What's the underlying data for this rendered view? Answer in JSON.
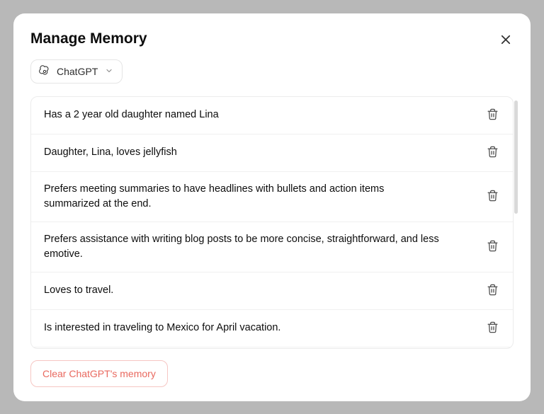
{
  "header": {
    "title": "Manage Memory"
  },
  "model_selector": {
    "label": "ChatGPT"
  },
  "memories": [
    {
      "text": "Has a 2 year old daughter named Lina"
    },
    {
      "text": "Daughter, Lina, loves jellyfish"
    },
    {
      "text": "Prefers meeting summaries to have headlines with bullets and action items summarized at the end."
    },
    {
      "text": "Prefers assistance with writing blog posts to be more concise, straightforward, and less emotive."
    },
    {
      "text": "Loves to travel."
    },
    {
      "text": "Is interested in traveling to Mexico for April vacation."
    }
  ],
  "footer": {
    "clear_label": "Clear ChatGPT's memory"
  }
}
